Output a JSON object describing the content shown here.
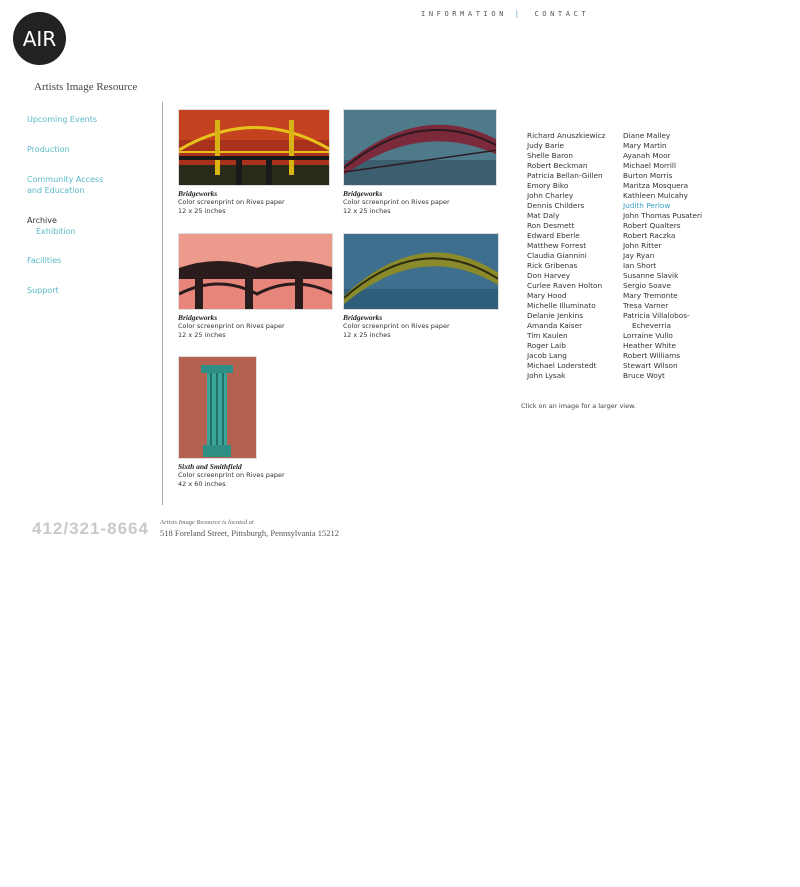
{
  "brand": {
    "logo_text": "AIR",
    "subtitle": "Artists Image Resource"
  },
  "topnav": {
    "information": "INFORMATION",
    "separator": "|",
    "contact": "CONTACT"
  },
  "sidebar": {
    "upcoming": "Upcoming Events",
    "production": "Production",
    "community_line1": "Community Access",
    "community_line2": "and Education",
    "archive": "Archive",
    "exhibition": "Exhibition",
    "facilities": "Facilities",
    "support": "Support"
  },
  "artworks": [
    {
      "title": "Bridgeworks",
      "medium": "Color screenprint on Rives paper",
      "size": "12 x 25 inches"
    },
    {
      "title": "Bridgeworks",
      "medium": "Color screenprint on Rives paper",
      "size": "12 x 25 inches"
    },
    {
      "title": "Bridgeworks",
      "medium": "Color screenprint on Rives paper",
      "size": "12 x 25 inches"
    },
    {
      "title": "Bridgeworks",
      "medium": "Color screenprint on Rives paper",
      "size": "12 x 25 inches"
    },
    {
      "title": "Sixth and Smithfield",
      "medium": "Color screenprint on Rives paper",
      "size": "42 x 60 inches"
    }
  ],
  "artists_col1": [
    "Richard Anuszkiewicz",
    "Judy Barie",
    "Shelle Baron",
    "Robert Beckman",
    "Patricia Bellan-Gillen",
    "Emory Biko",
    "John Charley",
    "Dennis Childers",
    "Mat Daly",
    "Ron Desmett",
    "Edward Eberle",
    "Matthew Forrest",
    "Claudia Giannini",
    "Rick Gribenas",
    "Don Harvey",
    "Curlee Raven Holton",
    "Mary Hood",
    "Michelle Illuminato",
    "Delanie Jenkins",
    "Amanda Kaiser",
    "Tim Kaulen",
    "Roger Laib",
    "Jacob Lang",
    "Michael Loderstedt",
    "John Lysak"
  ],
  "artists_col2": [
    "Diane Malley",
    "Mary Martin",
    "Ayanah Moor",
    "Michael Morrill",
    "Burton Morris",
    "Maritza Mosquera",
    "Kathleen Mulcahy",
    "Judith Perlow",
    "John Thomas Pusateri",
    "Robert Qualters",
    "Robert Raczka",
    "John Ritter",
    "Jay Ryan",
    "Ian Short",
    "Susanne Slavik",
    "Sergio Soave",
    "Mary Tremonte",
    "Tresa Varner",
    "Patricia Villalobos-",
    "Echeverria",
    "Lorraine Vullo",
    "Heather White",
    "Robert Williams",
    "Stewart Wilson",
    "Bruce Woyt"
  ],
  "hint": "Click on an image for a larger view.",
  "footer": {
    "phone": "412/321-8664",
    "located": "Artists Image Resource is located at",
    "address": "518 Foreland Street, Pittsburgh, Pennsylvania 15212"
  },
  "colors": {
    "accent": "#3aa0c8",
    "nav_green": "#5ab9c8"
  }
}
